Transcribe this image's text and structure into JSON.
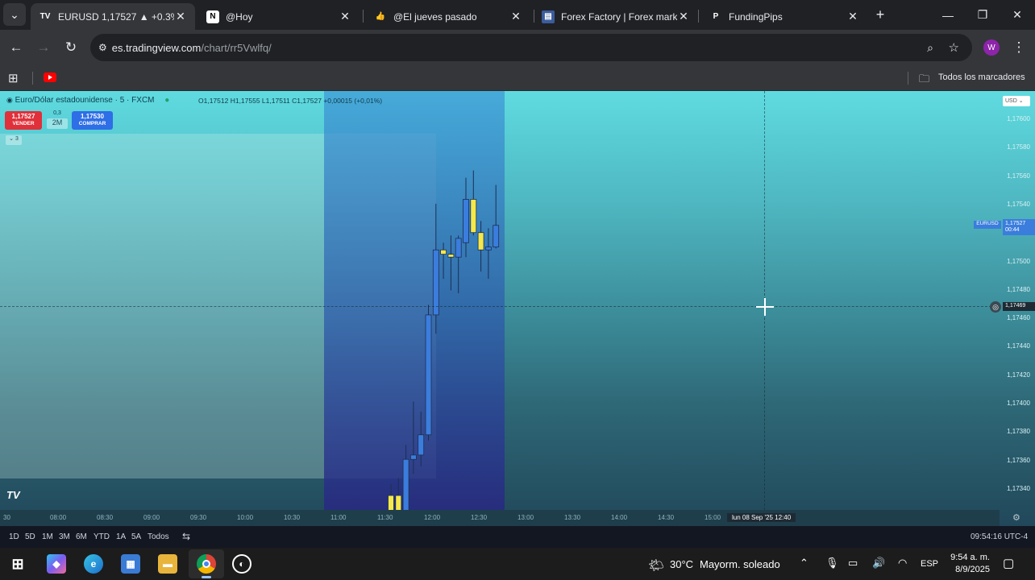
{
  "browser": {
    "tabs": [
      {
        "title": "EURUSD 1,17527 ▲ +0.3% (H",
        "favicon": "tradingview-icon"
      },
      {
        "title": "@Hoy",
        "favicon": "notion-icon"
      },
      {
        "title": "@El jueves pasado",
        "favicon": "thumbs-up-icon"
      },
      {
        "title": "Forex Factory | Forex market",
        "favicon": "forex-factory-icon"
      },
      {
        "title": "FundingPips",
        "favicon": "fundingpips-icon"
      }
    ],
    "new_tab_label": "+",
    "url_host": "es.tradingview.com",
    "url_path": "/chart/rr5Vwlfq/",
    "profile_initial": "W",
    "bookmarks_folder": "Todos los marcadores"
  },
  "chart": {
    "symbol_title": "Euro/Dólar estadounidense · 5 · FXCM",
    "ohlc": "O1,17512 H1,17555 L1,17511 C1,17527 +0,00015 (+0,01%)",
    "sell": {
      "price": "1,17527",
      "label": "VENDER"
    },
    "spread": {
      "top": "0,3",
      "label": "2M"
    },
    "buy": {
      "price": "1,17530",
      "label": "COMPRAR"
    },
    "indicators_toggle": "3",
    "currency": "USD",
    "price_labels": [
      "1,17600",
      "1,17580",
      "1,17560",
      "1,17540",
      "1,17520",
      "1,17500",
      "1,17480",
      "1,17460",
      "1,17440",
      "1,17420",
      "1,17400",
      "1,17380",
      "1,17360",
      "1,17340"
    ],
    "current_price_tag": {
      "symbol": "EURUSD",
      "price": "1,17527",
      "countdown": "00:44"
    },
    "crosshair_price": "1,17469",
    "crosshair_time": "lun 08 Sep '25   12:40",
    "time_labels": [
      "30",
      "08:00",
      "08:30",
      "09:00",
      "09:30",
      "10:00",
      "10:30",
      "11:00",
      "11:30",
      "12:00",
      "12:30",
      "13:00",
      "13:30",
      "14:00",
      "14:30",
      "15:00",
      "15:30"
    ],
    "logo": "TV",
    "colors": {
      "bull": "#3b7ddd",
      "bear": "#f5e84a",
      "sell": "#e0303a",
      "buy": "#2e6ee6"
    }
  },
  "chart_data": {
    "type": "candlestick",
    "series": [
      {
        "o": 1.1734,
        "h": 1.17348,
        "l": 1.17318,
        "c": 1.17318
      },
      {
        "o": 1.1734,
        "h": 1.17352,
        "l": 1.17318,
        "c": 1.17318
      },
      {
        "o": 1.17318,
        "h": 1.17375,
        "l": 1.17318,
        "c": 1.17365
      },
      {
        "o": 1.17365,
        "h": 1.17405,
        "l": 1.17355,
        "c": 1.17368
      },
      {
        "o": 1.17368,
        "h": 1.17398,
        "l": 1.1736,
        "c": 1.17382
      },
      {
        "o": 1.17382,
        "h": 1.17472,
        "l": 1.17378,
        "c": 1.17465
      },
      {
        "o": 1.17465,
        "h": 1.17542,
        "l": 1.17452,
        "c": 1.1751
      },
      {
        "o": 1.1751,
        "h": 1.17515,
        "l": 1.1749,
        "c": 1.17507
      },
      {
        "o": 1.17507,
        "h": 1.1752,
        "l": 1.17482,
        "c": 1.17505
      },
      {
        "o": 1.17505,
        "h": 1.1752,
        "l": 1.1748,
        "c": 1.17518
      },
      {
        "o": 1.17515,
        "h": 1.1756,
        "l": 1.17505,
        "c": 1.17545
      },
      {
        "o": 1.17545,
        "h": 1.17565,
        "l": 1.1752,
        "c": 1.17522
      },
      {
        "o": 1.17522,
        "h": 1.1753,
        "l": 1.17495,
        "c": 1.1751
      },
      {
        "o": 1.1751,
        "h": 1.17525,
        "l": 1.1749,
        "c": 1.17512
      },
      {
        "o": 1.17512,
        "h": 1.17555,
        "l": 1.17511,
        "c": 1.17527
      }
    ],
    "ylim": [
      1.1733,
      1.1762
    ]
  },
  "rangebar": {
    "ranges": [
      "1D",
      "5D",
      "1M",
      "3M",
      "6M",
      "YTD",
      "1A",
      "5A",
      "Todos"
    ],
    "clock": "09:54:16 UTC-4"
  },
  "taskbar": {
    "weather_temp": "30°C",
    "weather_desc": "Mayorm. soleado",
    "lang": "ESP",
    "time": "9:54 a. m.",
    "date": "8/9/2025"
  }
}
